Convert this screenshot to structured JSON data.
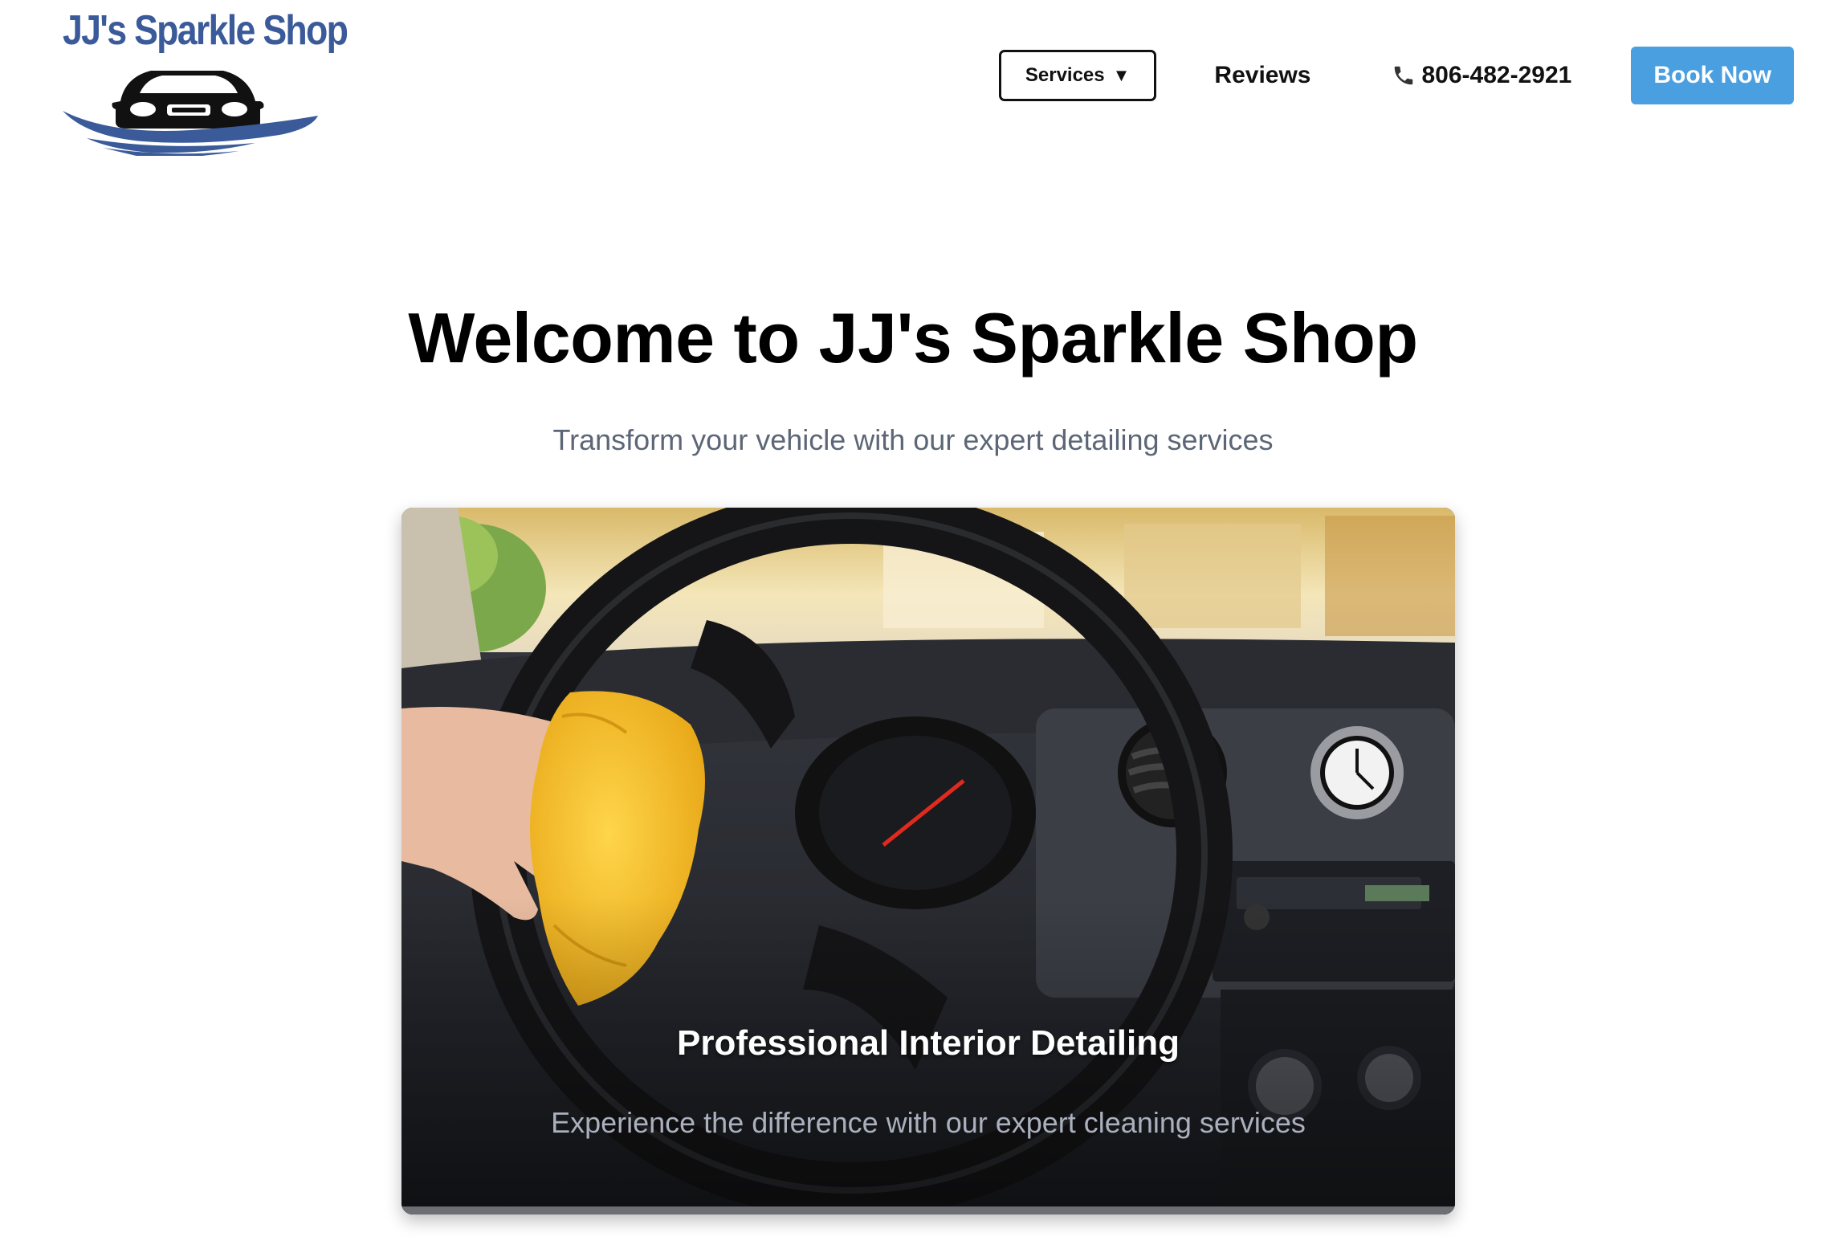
{
  "brand": {
    "logo_text": "JJ's Sparkle Shop",
    "colors": {
      "logo_blue": "#3a5a9a",
      "accent": "#4a9fe0"
    }
  },
  "nav": {
    "services_label": "Services",
    "services_caret": "▼",
    "reviews_label": "Reviews",
    "phone_icon": "phone-icon",
    "phone_number": "806-482-2921",
    "book_label": "Book Now"
  },
  "hero": {
    "title": "Welcome to JJ's Sparkle Shop",
    "subtitle": "Transform your vehicle with our expert detailing services"
  },
  "slide": {
    "title": "Professional Interior Detailing",
    "text": "Experience the difference with our expert cleaning services"
  }
}
